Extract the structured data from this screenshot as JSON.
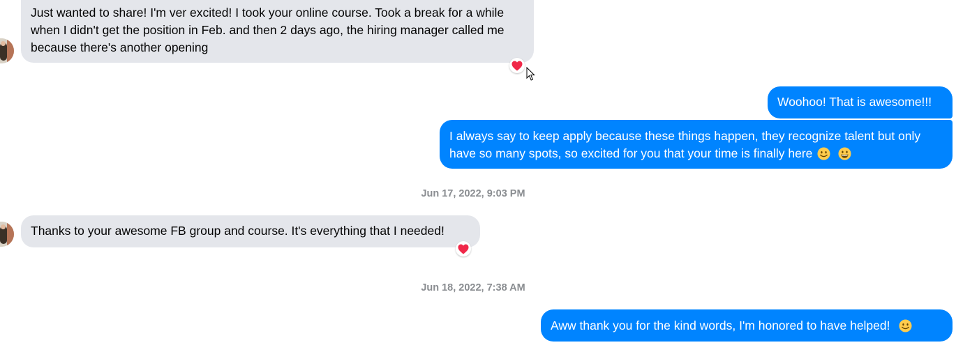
{
  "messages": [
    {
      "text": "Just wanted to share! I'm ver excited! I took your online course. Took a break for a while when I didn't get the position in Feb. and then 2 days ago, the hiring manager called me because there's another opening",
      "reaction": "heart-icon"
    },
    {
      "text": "Woohoo! That is awesome!!!"
    },
    {
      "text": "I always say to keep apply because these things happen, they recognize talent but only have so many spots, so excited for you that your time is finally here",
      "emojis": [
        "smile-emoji-icon",
        "grin-emoji-icon"
      ]
    },
    {
      "text": "Thanks to your awesome FB group and course. It's everything that I needed!",
      "reaction": "heart-icon"
    },
    {
      "text": "Aww thank you for the kind words, I'm honored to have helped!",
      "emojis": [
        "smile-emoji-icon"
      ]
    }
  ],
  "timestamps": [
    "Jun 17, 2022, 9:03 PM",
    "Jun 18, 2022, 7:38 AM"
  ],
  "colors": {
    "incoming_bubble": "#e4e6eb",
    "outgoing_bubble": "#0084ff",
    "timestamp_text": "#8a8d91",
    "reaction_heart": "#f02849"
  }
}
